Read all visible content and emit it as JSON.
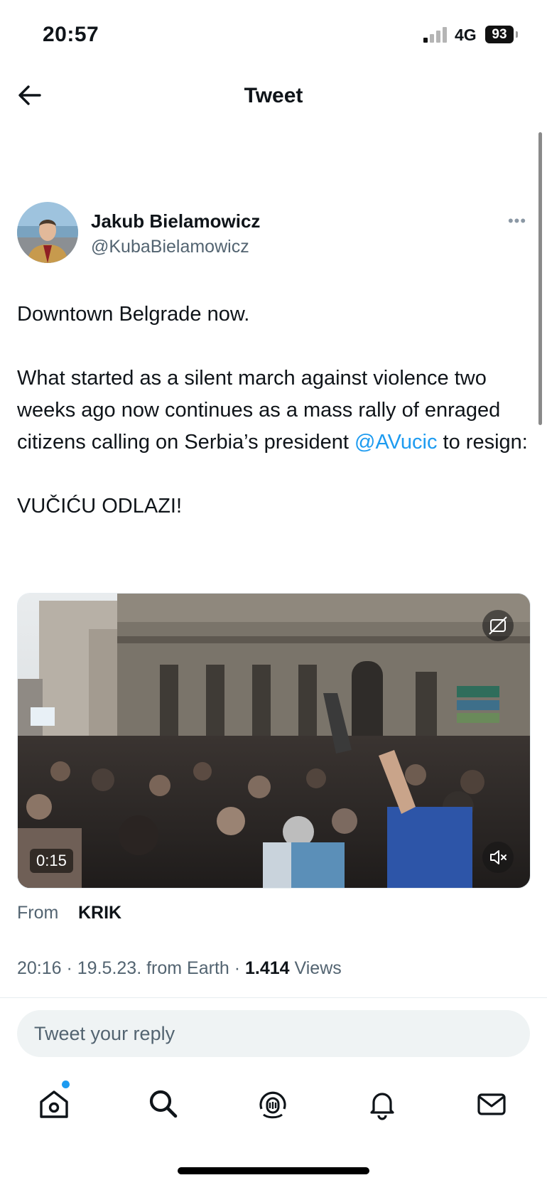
{
  "status_bar": {
    "time": "20:57",
    "network": "4G",
    "battery": "93"
  },
  "header": {
    "title": "Tweet"
  },
  "author": {
    "name": "Jakub Bielamowicz",
    "handle": "@KubaBielamowicz"
  },
  "tweet": {
    "line1": "Downtown Belgrade now.",
    "body_before_mention": "What started as a silent march against violence two weeks ago now continues as a mass rally of enraged citizens calling on Serbia’s president ",
    "mention": "@AVucic",
    "body_after_mention": " to resign:",
    "closing": "VUČIĆU ODLAZI!"
  },
  "media": {
    "duration": "0:15",
    "source_label": "From",
    "source_name": "KRIK"
  },
  "meta": {
    "time": "20:16",
    "date": "19.5.23.",
    "client": "from Earth",
    "views_count": "1.414",
    "views_label": "Views"
  },
  "reply": {
    "placeholder": "Tweet your reply"
  },
  "tabs": [
    "home-icon",
    "search-icon",
    "spaces-icon",
    "notifications-icon",
    "messages-icon"
  ],
  "colors": {
    "accent": "#1d9bf0",
    "text": "#0f1419",
    "secondary": "#536471",
    "reply_bg": "#eff3f4"
  }
}
